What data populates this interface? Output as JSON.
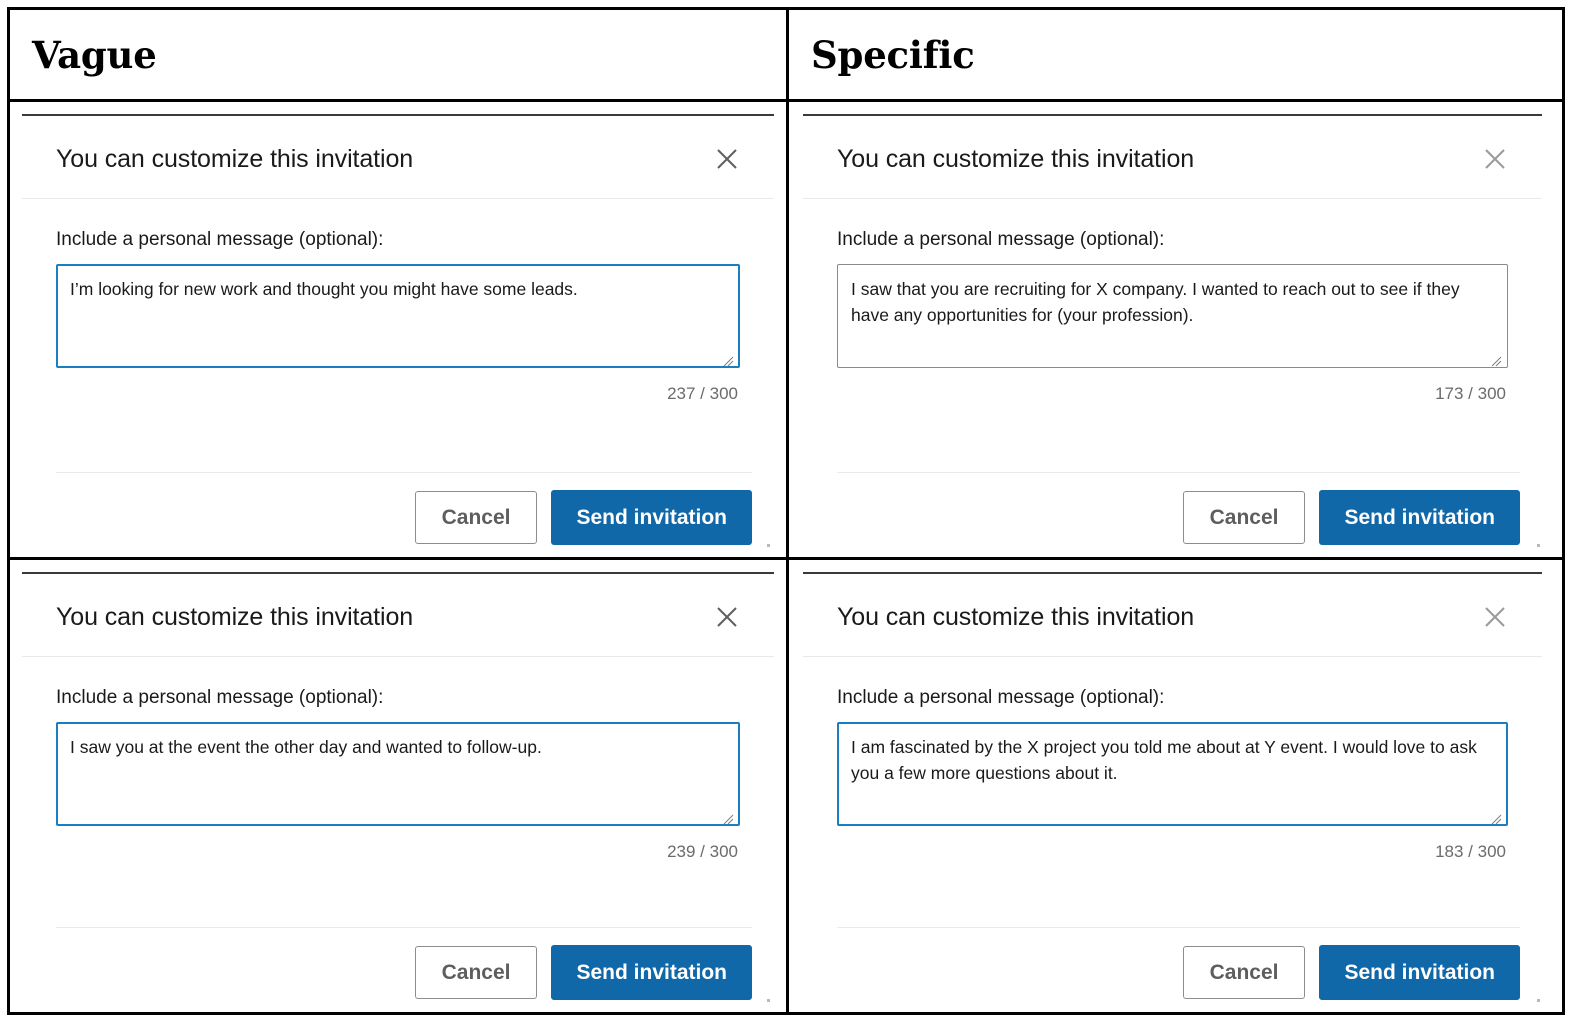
{
  "columns": [
    {
      "heading": "Vague"
    },
    {
      "heading": "Specific"
    }
  ],
  "dialog": {
    "title": "You can customize this invitation",
    "close_icon": "close-icon",
    "field_label": "Include a personal message (optional):",
    "cancel_label": "Cancel",
    "send_label": "Send invitation",
    "resize_icon": "resize-grip-icon"
  },
  "colors": {
    "primary_blue": "#1168a9",
    "focus_blue": "#1a7fc1",
    "idle_border": "#8a8a8a",
    "counter_gray": "#6b6b6b",
    "grid_black": "#000000"
  },
  "cards": [
    {
      "id": "vague-top",
      "column": "Vague",
      "message": "I’m looking for new work and thought you might have some leads.",
      "counter": "237 / 300",
      "count": 237,
      "limit": 300,
      "focused": true
    },
    {
      "id": "specific-top",
      "column": "Specific",
      "message": "I saw that you are recruiting for X company. I wanted to reach out to see if they have any opportunities for (your profession).",
      "counter": "173 / 300",
      "count": 173,
      "limit": 300,
      "focused": false
    },
    {
      "id": "vague-bottom",
      "column": "Vague",
      "message": "I saw you at the event the other day and wanted to follow-up.",
      "counter": "239 / 300",
      "count": 239,
      "limit": 300,
      "focused": true
    },
    {
      "id": "specific-bottom",
      "column": "Specific",
      "message": "I am fascinated by the X project you told me about at Y event. I would love to ask you a few more questions about it.",
      "counter": "183 / 300",
      "count": 183,
      "limit": 300,
      "focused": true
    }
  ]
}
